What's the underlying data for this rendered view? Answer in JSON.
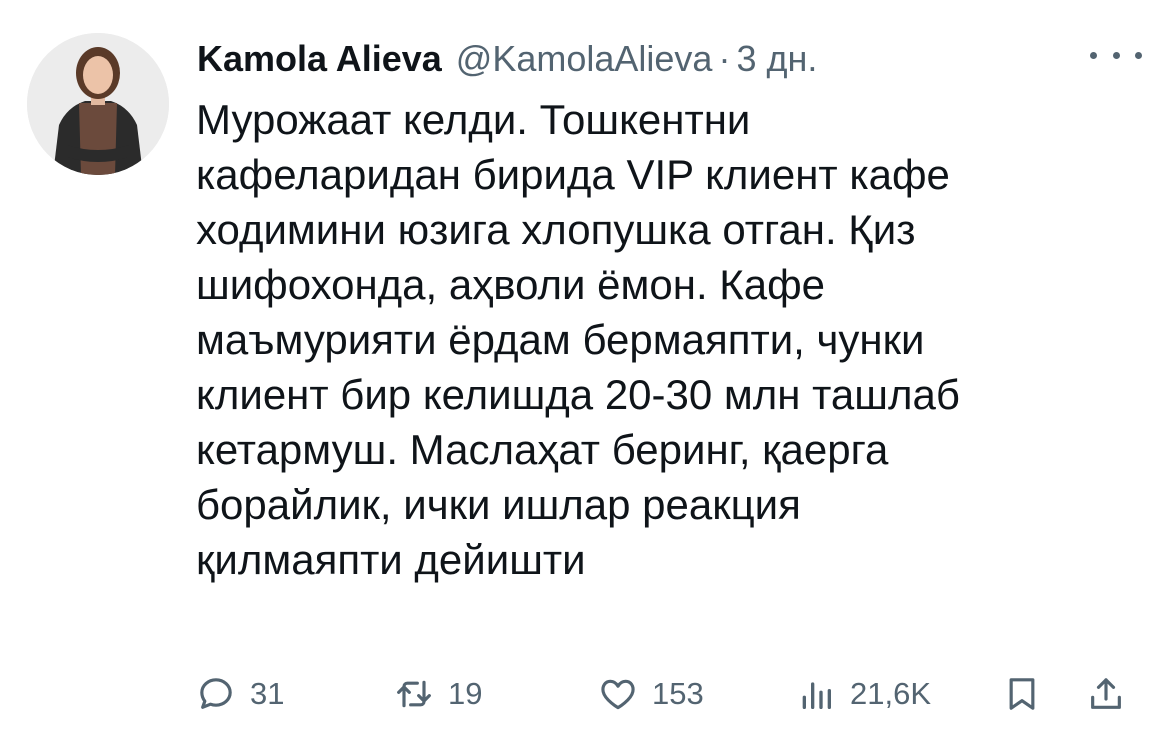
{
  "tweet": {
    "author_name": "Kamola Alieva",
    "handle": "@KamolaAlieva",
    "separator": "·",
    "time": "3 дн.",
    "text": "Мурожаат келди. Тошкентни\nкафеларидан бирида VIP клиент кафе\nходимини юзига хлопушка отган. Қиз\nшифохонда, аҳволи ёмон. Кафе\nмаъмурияти ёрдам бермаяпти, чунки\nклиент бир келишда 20-30 млн ташлаб\nкетармуш. Маслаҳат беринг, қаерга\nборайлик, ички ишлар реакция\nқилмаяпти дейишти"
  },
  "actions": {
    "replies": "31",
    "reposts": "19",
    "likes": "153",
    "views": "21,6K"
  },
  "icons": {
    "reply": "reply-icon",
    "repost": "repost-icon",
    "like": "heart-icon",
    "views": "views-icon",
    "bookmark": "bookmark-icon",
    "share": "share-icon",
    "more": "more-icon"
  },
  "colors": {
    "text": "#0f1419",
    "secondary": "#536471",
    "background": "#ffffff"
  }
}
